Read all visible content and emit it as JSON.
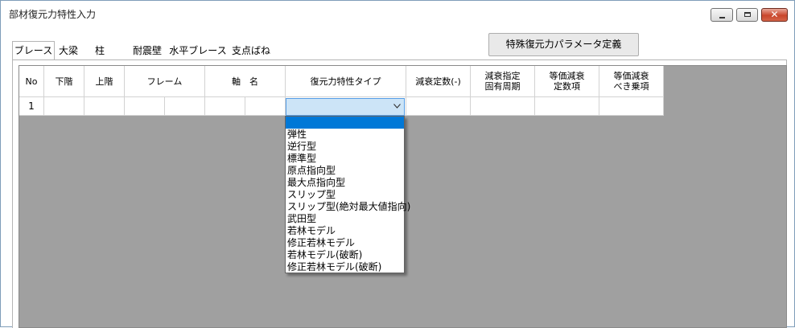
{
  "window": {
    "title": "部材復元力特性入力",
    "minimize_glyph": "",
    "maximize_glyph": "",
    "close_glyph": "✕"
  },
  "tabs": [
    {
      "label": "ブレース",
      "active": true
    },
    {
      "label": "大梁",
      "active": false
    },
    {
      "label": "柱",
      "active": false
    },
    {
      "label": "耐震壁",
      "active": false
    },
    {
      "label": "水平ブレース",
      "active": false
    },
    {
      "label": "支点ばね",
      "active": false
    }
  ],
  "special_button": {
    "label": "特殊復元力パラメータ定義"
  },
  "table": {
    "headers": [
      "No",
      "下階",
      "上階",
      "フレーム",
      "軸　名",
      "復元力特性タイプ",
      "減衰定数(-)",
      "減衰指定\n固有周期",
      "等価減衰\n定数項",
      "等価減衰\nべき乗項"
    ],
    "rows": [
      {
        "no": "1",
        "restoring_type": ""
      }
    ]
  },
  "dropdown": {
    "chevron_icon": "chevron-down-icon",
    "options": [
      "",
      "弾性",
      "逆行型",
      "標準型",
      "原点指向型",
      "最大点指向型",
      "スリップ型",
      "スリップ型(絶対最大値指向)",
      "武田型",
      "若林モデル",
      "修正若林モデル",
      "若林モデル(破断)",
      "修正若林モデル(破断)"
    ],
    "selected_index": 0
  },
  "colors": {
    "grid_background": "#a0a0a0",
    "selected_highlight": "#0078d7",
    "combo_focus": "#cce4f7"
  }
}
